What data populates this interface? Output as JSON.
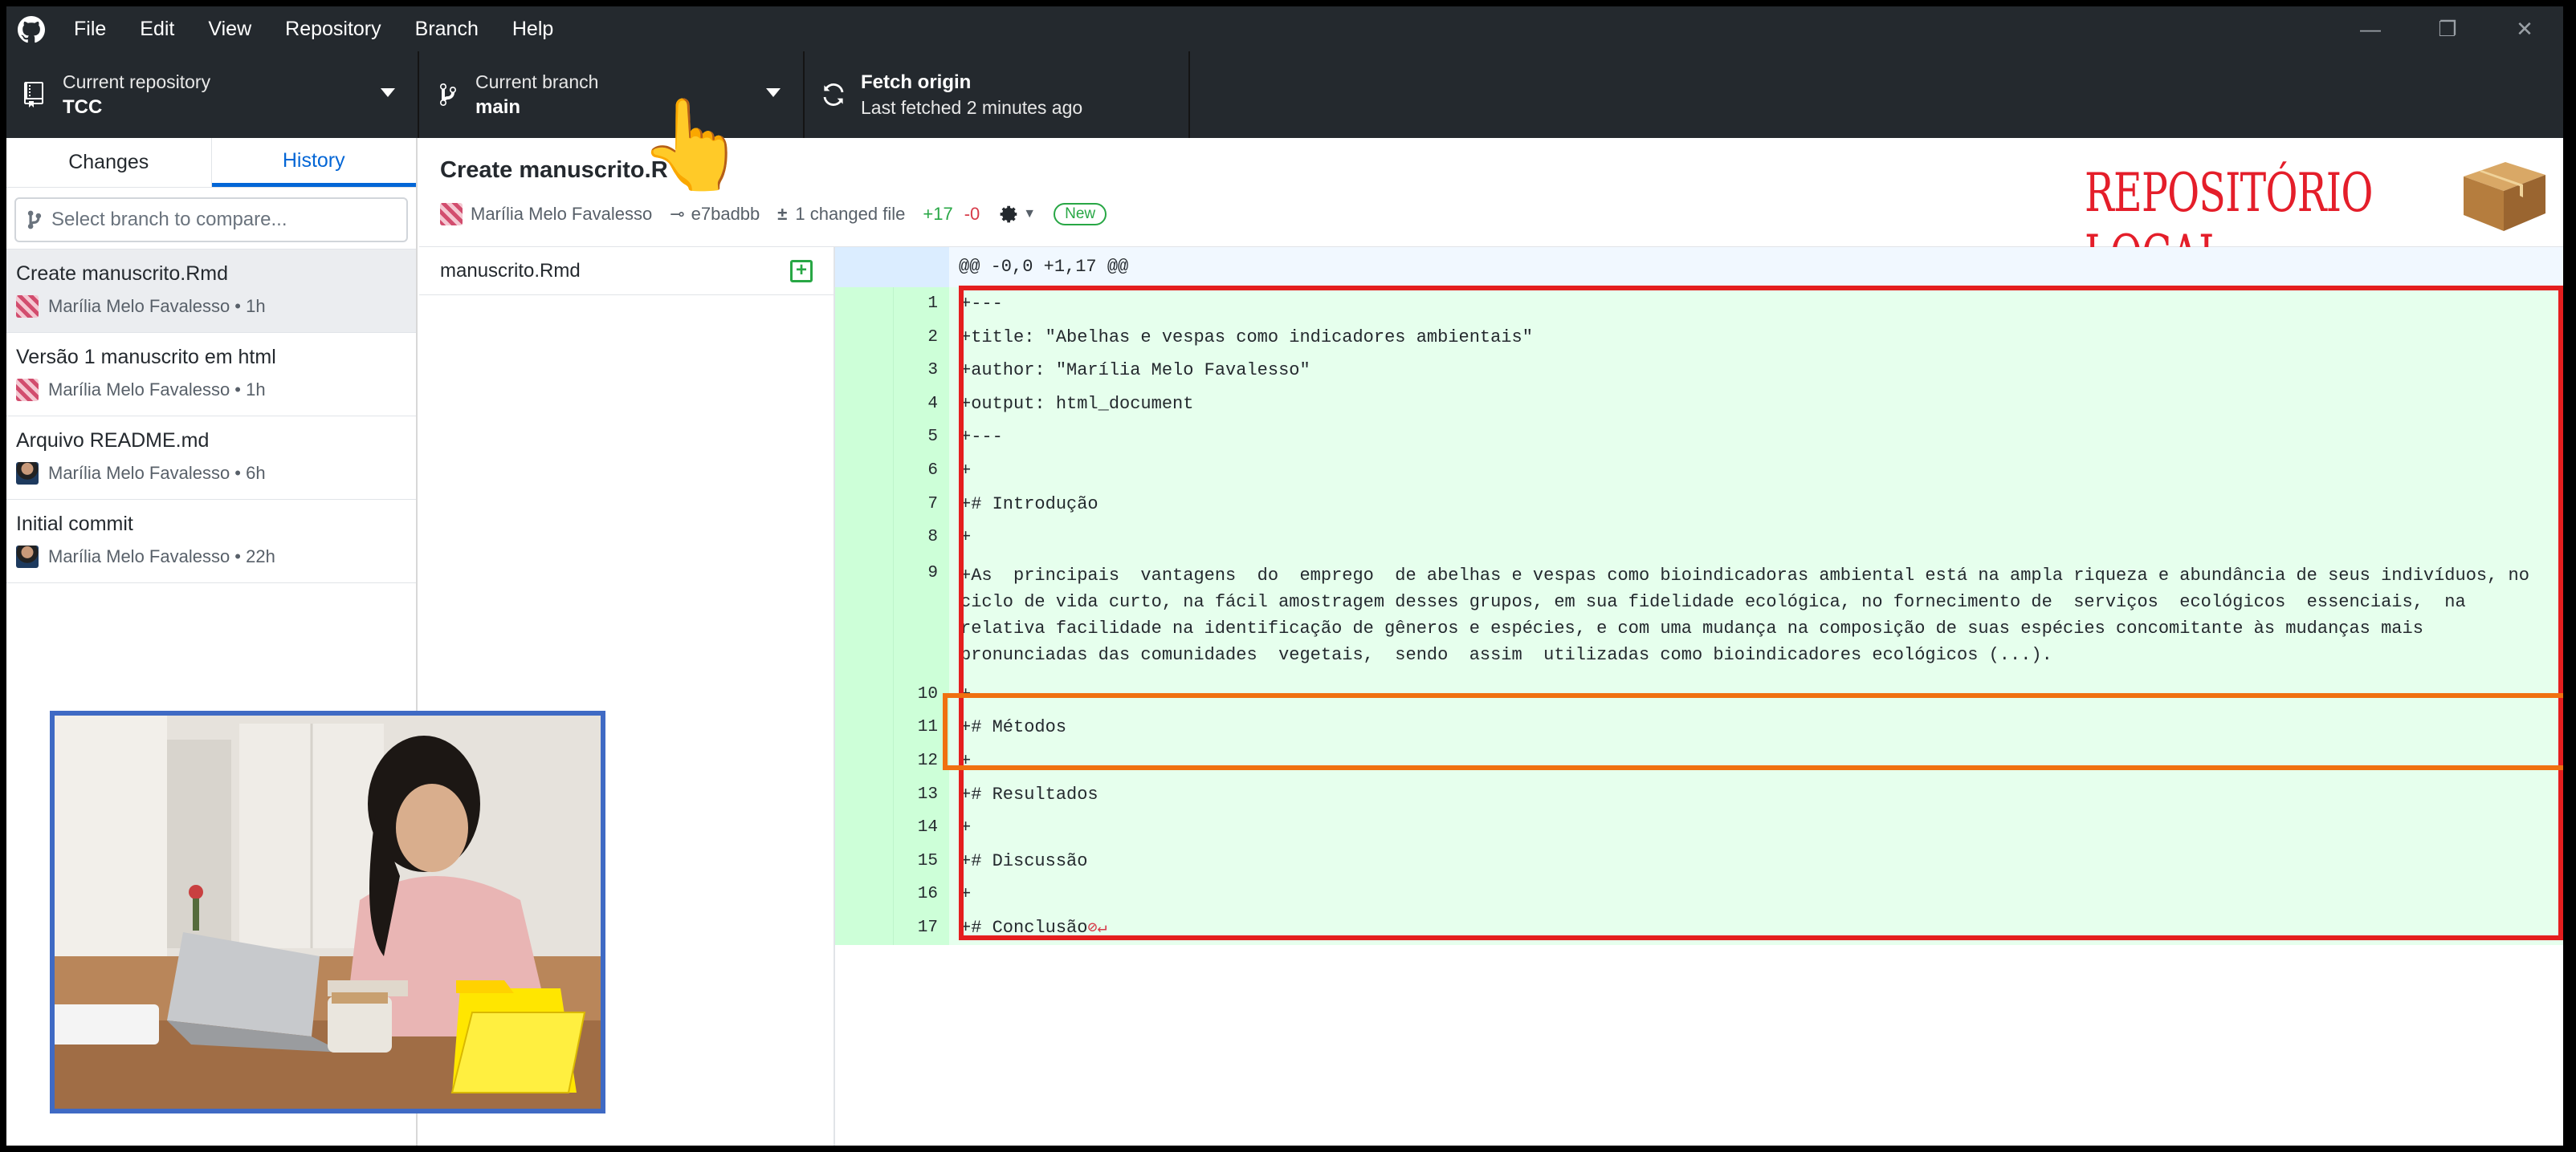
{
  "menu": [
    "File",
    "Edit",
    "View",
    "Repository",
    "Branch",
    "Help"
  ],
  "window_controls": {
    "minimize": "—",
    "restore": "❐",
    "close": "✕"
  },
  "toolbar": {
    "repository": {
      "label": "Current repository",
      "value": "TCC"
    },
    "branch": {
      "label": "Current branch",
      "value": "main"
    },
    "fetch": {
      "label": "Fetch origin",
      "sub": "Last fetched 2 minutes ago"
    }
  },
  "sidebar": {
    "tabs": [
      "Changes",
      "History"
    ],
    "active_tab": "History",
    "compare_placeholder": "Select branch to compare...",
    "commits": [
      {
        "title": "Create manuscrito.Rmd",
        "meta": "Marília Melo Favalesso • 1h",
        "avatar": "pink"
      },
      {
        "title": "Versão 1 manuscrito em html",
        "meta": "Marília Melo Favalesso • 1h",
        "avatar": "pink"
      },
      {
        "title": "Arquivo README.md",
        "meta": "Marília Melo Favalesso • 6h",
        "avatar": "photo"
      },
      {
        "title": "Initial commit",
        "meta": "Marília Melo Favalesso • 22h",
        "avatar": "photo"
      }
    ]
  },
  "commit": {
    "title": "Create manuscrito.R",
    "author": "Marília Melo Favalesso",
    "sha": "e7badbb",
    "changed": "1 changed file",
    "additions": "+17",
    "deletions": "-0",
    "badge": "New"
  },
  "annotation": {
    "local_label": "REPOSITÓRIO LOCAL"
  },
  "file": {
    "name": "manuscrito.Rmd"
  },
  "diff": {
    "hunk": "@@ -0,0 +1,17 @@",
    "lines": [
      {
        "n": "1",
        "text": "+---"
      },
      {
        "n": "2",
        "text": "+title: \"Abelhas e vespas como indicadores ambientais\""
      },
      {
        "n": "3",
        "text": "+author: \"Marília Melo Favalesso\""
      },
      {
        "n": "4",
        "text": "+output: html_document"
      },
      {
        "n": "5",
        "text": "+---"
      },
      {
        "n": "6",
        "text": "+"
      },
      {
        "n": "7",
        "text": "+# Introdução"
      },
      {
        "n": "8",
        "text": "+"
      },
      {
        "n": "9",
        "text": "+As  principais  vantagens  do  emprego  de abelhas e vespas como bioindicadoras ambiental está na ampla riqueza e abundância de seus indivíduos, no ciclo de vida curto, na fácil amostragem desses grupos, em sua fidelidade ecológica, no fornecimento de  serviços  ecológicos  essenciais,  na  relativa facilidade na identificação de gêneros e espécies, e com uma mudança na composição de suas espécies concomitante às mudanças mais pronunciadas das comunidades  vegetais,  sendo  assim  utilizadas como bioindicadores ecológicos (...)."
      },
      {
        "n": "10",
        "text": "+"
      },
      {
        "n": "11",
        "text": "+# Métodos"
      },
      {
        "n": "12",
        "text": "+"
      },
      {
        "n": "13",
        "text": "+# Resultados"
      },
      {
        "n": "14",
        "text": "+"
      },
      {
        "n": "15",
        "text": "+# Discussão"
      },
      {
        "n": "16",
        "text": "+"
      },
      {
        "n": "17",
        "text": "+# Conclusão"
      }
    ],
    "no_newline_marker": "⊘↵"
  }
}
